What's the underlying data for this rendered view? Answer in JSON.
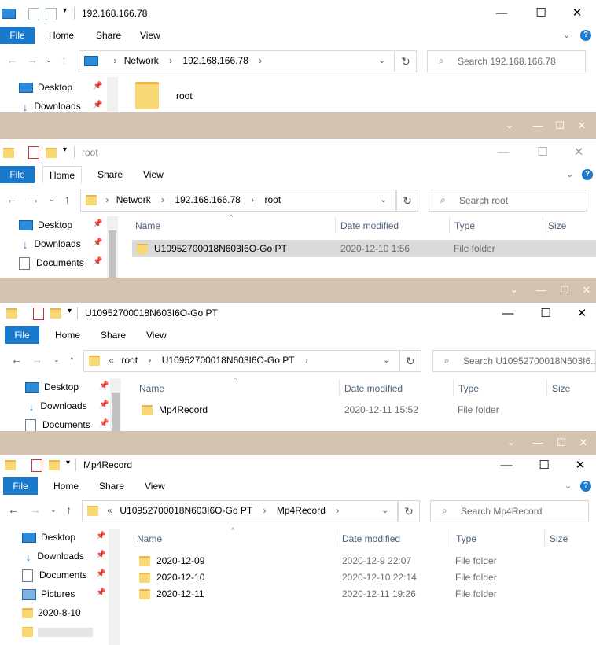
{
  "ribbon": {
    "file": "File",
    "home": "Home",
    "share": "Share",
    "view": "View"
  },
  "win1": {
    "title": "192.168.166.78",
    "crumbs": [
      "Network",
      "192.168.166.78"
    ],
    "search_placeholder": "Search 192.168.166.78",
    "nav": [
      {
        "label": "Desktop"
      },
      {
        "label": "Downloads"
      }
    ],
    "items": [
      {
        "name": "root"
      }
    ]
  },
  "win2": {
    "title": "root",
    "crumbs": [
      "Network",
      "192.168.166.78",
      "root"
    ],
    "search_placeholder": "Search root",
    "nav": [
      {
        "label": "Desktop"
      },
      {
        "label": "Downloads"
      },
      {
        "label": "Documents"
      }
    ],
    "columns": {
      "name": "Name",
      "date": "Date modified",
      "type": "Type",
      "size": "Size"
    },
    "rows": [
      {
        "name": "U10952700018N603I6O-Go PT",
        "date": "2020-12-10 1:56",
        "type": "File folder"
      }
    ]
  },
  "win3": {
    "title": "U10952700018N603I6O-Go PT",
    "crumbs": [
      "«",
      "root",
      "U10952700018N603I6O-Go PT"
    ],
    "search_placeholder": "Search U10952700018N603I6...",
    "nav": [
      {
        "label": "Desktop"
      },
      {
        "label": "Downloads"
      },
      {
        "label": "Documents"
      }
    ],
    "columns": {
      "name": "Name",
      "date": "Date modified",
      "type": "Type",
      "size": "Size"
    },
    "rows": [
      {
        "name": "Mp4Record",
        "date": "2020-12-11 15:52",
        "type": "File folder"
      }
    ]
  },
  "win4": {
    "title": "Mp4Record",
    "crumbs": [
      "«",
      "U10952700018N603I6O-Go PT",
      "Mp4Record"
    ],
    "search_placeholder": "Search Mp4Record",
    "nav": [
      {
        "label": "Desktop"
      },
      {
        "label": "Downloads"
      },
      {
        "label": "Documents"
      },
      {
        "label": "Pictures"
      },
      {
        "label": "2020-8-10"
      }
    ],
    "columns": {
      "name": "Name",
      "date": "Date modified",
      "type": "Type",
      "size": "Size"
    },
    "rows": [
      {
        "name": "2020-12-09",
        "date": "2020-12-9 22:07",
        "type": "File folder"
      },
      {
        "name": "2020-12-10",
        "date": "2020-12-10 22:14",
        "type": "File folder"
      },
      {
        "name": "2020-12-11",
        "date": "2020-12-11 19:26",
        "type": "File folder"
      }
    ]
  },
  "icons": {
    "minimize": "minimize-icon",
    "maximize": "maximize-icon",
    "close": "close-icon",
    "folder": "folder-icon"
  },
  "colors": {
    "file_tab": "#1979ca",
    "separator": "#d4c3ae",
    "selected_row": "#d9d9d9",
    "header_text": "#4c607a"
  }
}
